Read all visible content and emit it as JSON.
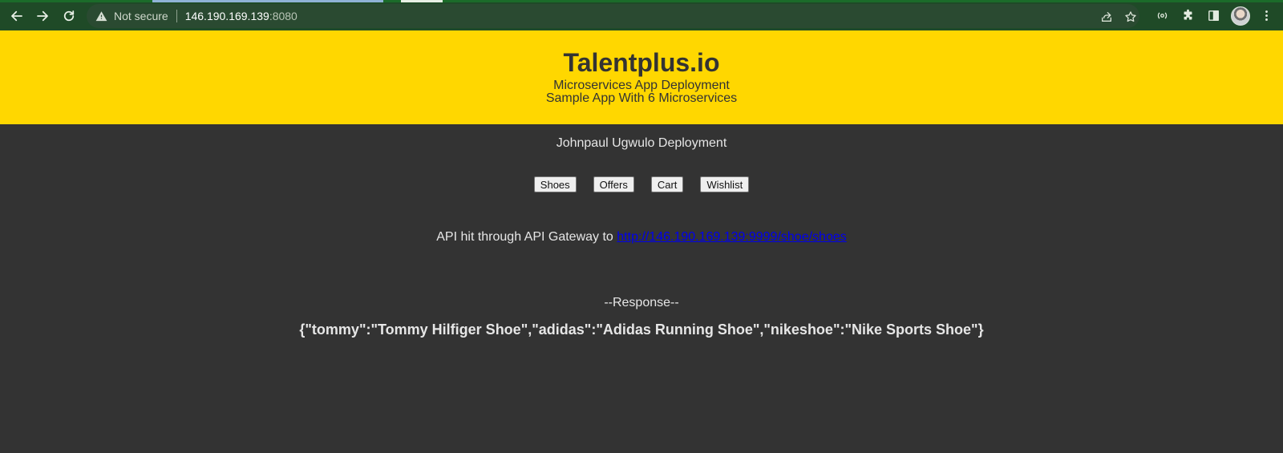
{
  "browser": {
    "security_label": "Not secure",
    "url_host": "146.190.169.139",
    "url_port": ":8080"
  },
  "banner": {
    "title": "Talentplus.io",
    "subtitle_1": "Microservices App Deployment",
    "subtitle_2": "Sample App With 6 Microservices"
  },
  "deployer": "Johnpaul Ugwulo Deployment",
  "nav": {
    "buttons": [
      "Shoes",
      "Offers",
      "Cart",
      "Wishlist"
    ]
  },
  "api": {
    "prefix": "API hit through API Gateway to",
    "link": "http://146.190.169.139:9999/shoe/shoes"
  },
  "response": {
    "label": "--Response--",
    "body": "{\"tommy\":\"Tommy Hilfiger Shoe\",\"adidas\":\"Adidas Running Shoe\",\"nikeshoe\":\"Nike Sports Shoe\"}"
  },
  "colors": {
    "banner": "#ffd700",
    "page_background": "#333333",
    "link": "#0000ee",
    "browser_frame": "#1f4a27"
  }
}
